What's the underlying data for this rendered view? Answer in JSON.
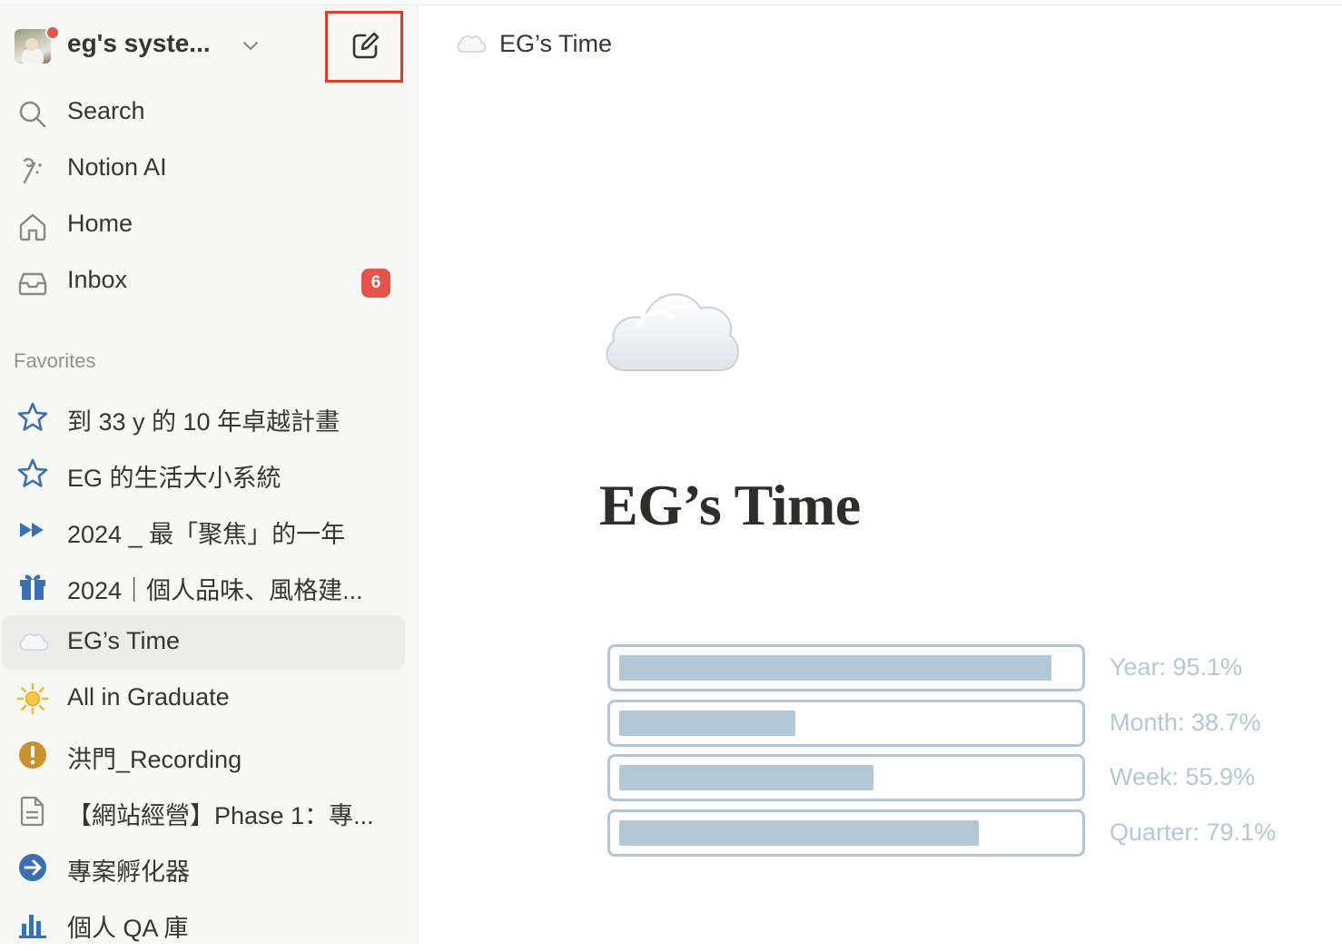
{
  "workspace": {
    "name": "eg's syste..."
  },
  "nav": [
    {
      "label": "Search",
      "icon": "search-icon"
    },
    {
      "label": "Notion AI",
      "icon": "notion-ai-icon"
    },
    {
      "label": "Home",
      "icon": "home-icon"
    },
    {
      "label": "Inbox",
      "icon": "inbox-icon",
      "badge": "6"
    }
  ],
  "favorites": {
    "section_label": "Favorites",
    "items": [
      {
        "label": "到 33 y 的 10 年卓越計畫",
        "icon": "star-outline-icon"
      },
      {
        "label": "EG 的生活大小系統",
        "icon": "star-outline-icon"
      },
      {
        "label": "2024 _ 最「聚焦」的一年",
        "icon": "fast-forward-icon"
      },
      {
        "label": "2024｜個人品味、風格建...",
        "icon": "gift-icon"
      },
      {
        "label": "EG’s Time",
        "icon": "cloud-icon",
        "active": true
      },
      {
        "label": "All in Graduate",
        "icon": "sun-icon"
      },
      {
        "label": "洪門_Recording",
        "icon": "exclamation-circle-icon"
      },
      {
        "label": "【網站經營】Phase 1：專...",
        "icon": "document-icon"
      },
      {
        "label": "專案孵化器",
        "icon": "arrow-right-circle-icon"
      },
      {
        "label": "個人 QA 庫",
        "icon": "bar-chart-icon"
      }
    ]
  },
  "breadcrumb": {
    "title": "EG’s Time",
    "icon": "cloud-icon"
  },
  "page": {
    "title": "EG’s Time",
    "icon": "cloud-icon",
    "progress": [
      {
        "label": "Year: 95.1%",
        "value": 0.951
      },
      {
        "label": "Month: 38.7%",
        "value": 0.387
      },
      {
        "label": "Week: 55.9%",
        "value": 0.559
      },
      {
        "label": "Quarter: 79.1%",
        "value": 0.791
      }
    ]
  },
  "colors": {
    "sidebar_bg": "#f7f7f5",
    "badge": "#e5534b",
    "highlight_box": "#e03c2e",
    "icon_blue": "#3a70b2",
    "progress_fill": "#b3c8d5",
    "progress_label": "#b2c8d7"
  }
}
